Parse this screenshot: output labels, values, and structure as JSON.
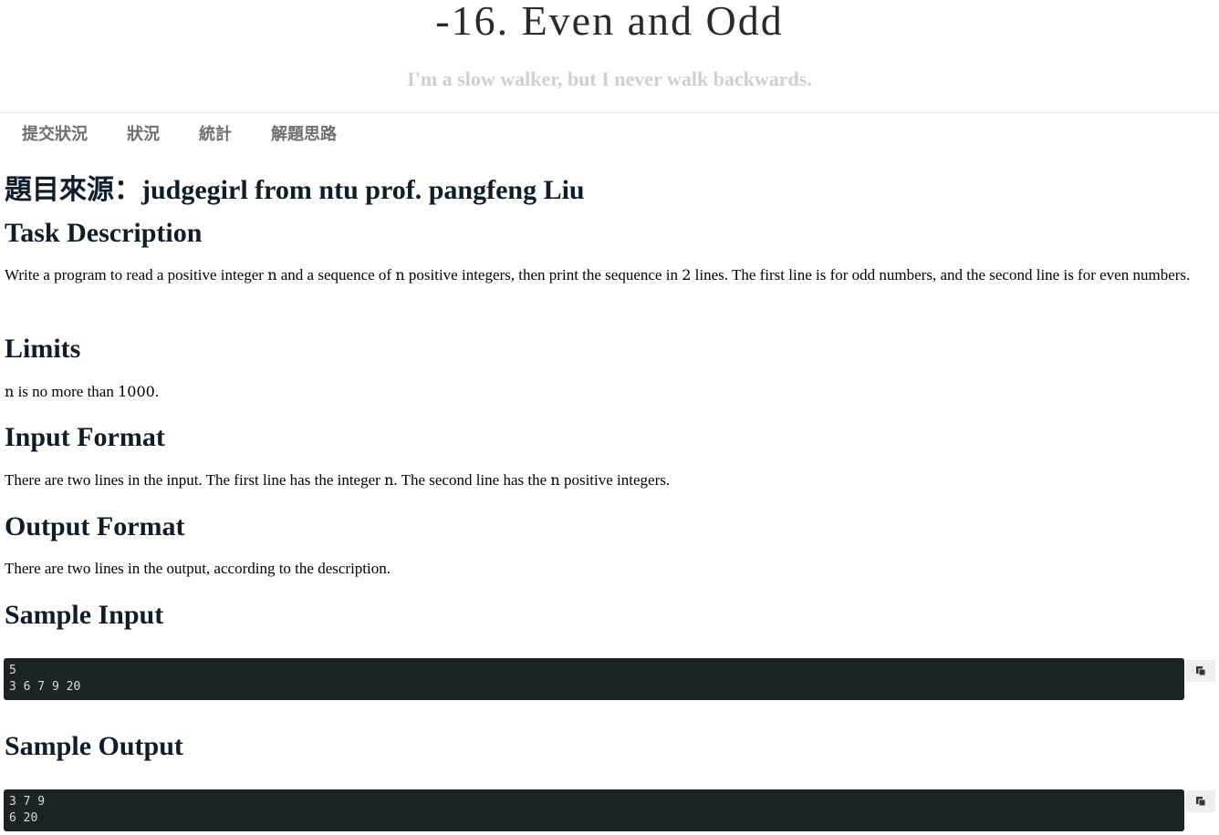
{
  "header": {
    "title": "-16. Even and Odd",
    "subtitle": "I'm a slow walker, but I never walk backwards."
  },
  "nav": {
    "items": [
      "提交狀況",
      "狀況",
      "統計",
      "解題思路"
    ]
  },
  "content": {
    "source_title": "題目來源：judgegirl from ntu prof. pangfeng Liu",
    "task": {
      "heading": "Task Description",
      "text_1": "Write a program to read a positive integer ",
      "var_n_1": "n",
      "text_2": " and a sequence of ",
      "var_n_2": "n",
      "text_3": " positive integers, then print the sequence in ",
      "num_2": "2",
      "text_4": " lines. The first line is for odd numbers, and the second line is for even numbers."
    },
    "limits": {
      "heading": "Limits",
      "var_n": "n",
      "text_1": " is no more than ",
      "num_1000": "1000",
      "text_2": "."
    },
    "input_format": {
      "heading": "Input Format",
      "text_1": "There are two lines in the input. The first line has the integer ",
      "var_n_1": "n",
      "text_2": ". The second line has the ",
      "var_n_2": "n",
      "text_3": " positive integers."
    },
    "output_format": {
      "heading": "Output Format",
      "text": "There are two lines in the output, according to the description."
    },
    "sample_input": {
      "heading": "Sample Input",
      "code": "5\n3 6 7 9 20"
    },
    "sample_output": {
      "heading": "Sample Output",
      "code": "3 7 9\n6 20"
    }
  },
  "icons": {
    "copy": "copy-icon"
  }
}
